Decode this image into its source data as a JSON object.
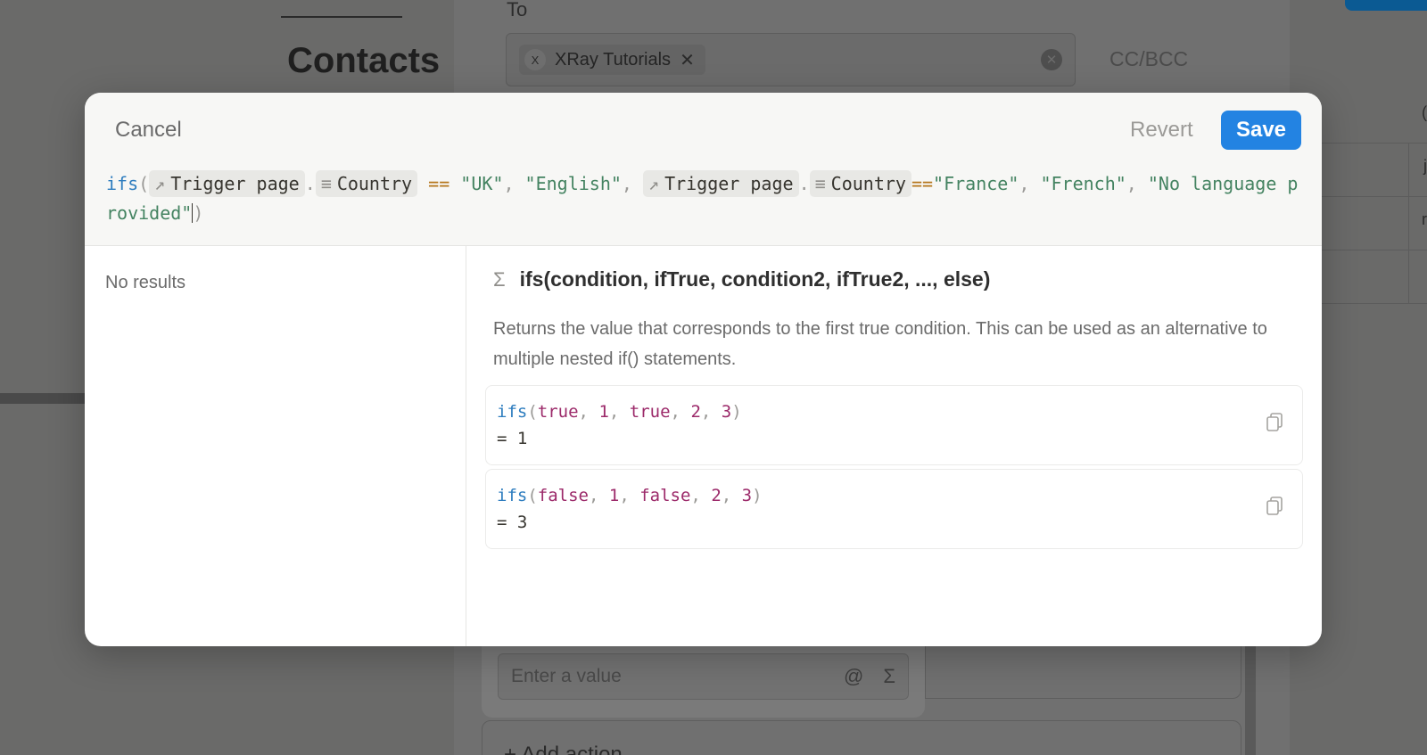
{
  "background": {
    "page_title": "Contacts",
    "right_letters": [
      "(",
      "j",
      "r"
    ]
  },
  "email": {
    "to_label": "To",
    "recipient_initial": "X",
    "recipient_name": "XRay Tutorials",
    "cc_bcc": "CC/BCC",
    "value_placeholder": "Enter a value",
    "mention_icon": "@",
    "formula_icon": "Σ",
    "add_action": "+ Add action"
  },
  "modal": {
    "cancel_label": "Cancel",
    "revert_label": "Revert",
    "save_label": "Save",
    "formula": {
      "fn": "ifs",
      "open_paren": "(",
      "token_trigger": "Trigger page",
      "dot": ".",
      "token_country": "Country",
      "eq_spaced": " == ",
      "str_uk": "\"UK\"",
      "comma": ", ",
      "str_english": "\"English\"",
      "eq_tight": "==",
      "str_france": "\"France\"",
      "str_french": "\"French\"",
      "str_none": "\"No language provided\"",
      "close_paren": ")"
    },
    "left_panel": {
      "no_results": "No results"
    },
    "docs": {
      "sigma": "Σ",
      "signature": "ifs(condition, ifTrue, condition2, ifTrue2, ..., else)",
      "description": "Returns the value that corresponds to the first true condition. This can be used as an alternative to multiple nested if() statements.",
      "examples": [
        {
          "fn": "ifs",
          "args": [
            "true",
            "1",
            "true",
            "2",
            "3"
          ],
          "result": "= 1"
        },
        {
          "fn": "ifs",
          "args": [
            "false",
            "1",
            "false",
            "2",
            "3"
          ],
          "result": "= 3"
        }
      ]
    }
  },
  "colors": {
    "accent": "#2383e2",
    "string": "#448361",
    "function": "#2e7dbf",
    "operator": "#b5761a",
    "literal": "#9c2a6a"
  }
}
